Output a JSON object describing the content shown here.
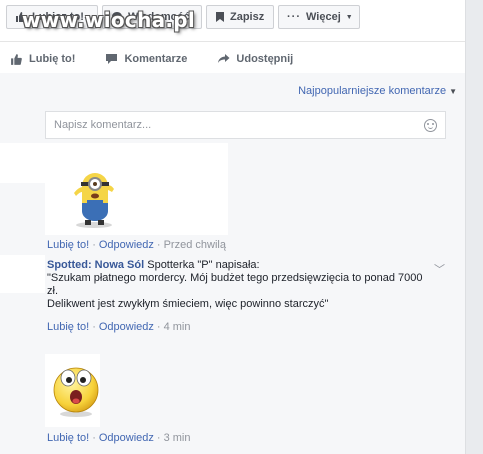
{
  "watermark": "www.wiocha.pl",
  "top_bar": {
    "like": "Lubisz to!",
    "message": "Wiadomość",
    "save": "Zapisz",
    "more": "Więcej"
  },
  "actions": {
    "like": "Lubię to!",
    "comment": "Komentarze",
    "share": "Udostępnij"
  },
  "sort_label": "Najpopularniejsze komentarze",
  "comment_input": {
    "placeholder": "Napisz komentarz..."
  },
  "comments": [
    {
      "sticker": "minion-sticker",
      "like": "Lubię to!",
      "reply": "Odpowiedz",
      "time": "Przed chwilą"
    },
    {
      "author": "Spotted: Nowa Sól",
      "text_line1": "Spotterka \"P\" napisała:",
      "text_line2": "\"Szukam płatnego mordercy. Mój budżet tego przedsięwzięcia to ponad 7000",
      "text_line3": "zł.",
      "text_line4": "Delikwent jest zwykłym śmieciem, więc powinno starczyć\"",
      "like": "Lubię to!",
      "reply": "Odpowiedz",
      "time": "4 min"
    },
    {
      "sticker": "surprised-emoji-sticker",
      "like": "Lubię to!",
      "reply": "Odpowiedz",
      "time": "3 min"
    }
  ]
}
